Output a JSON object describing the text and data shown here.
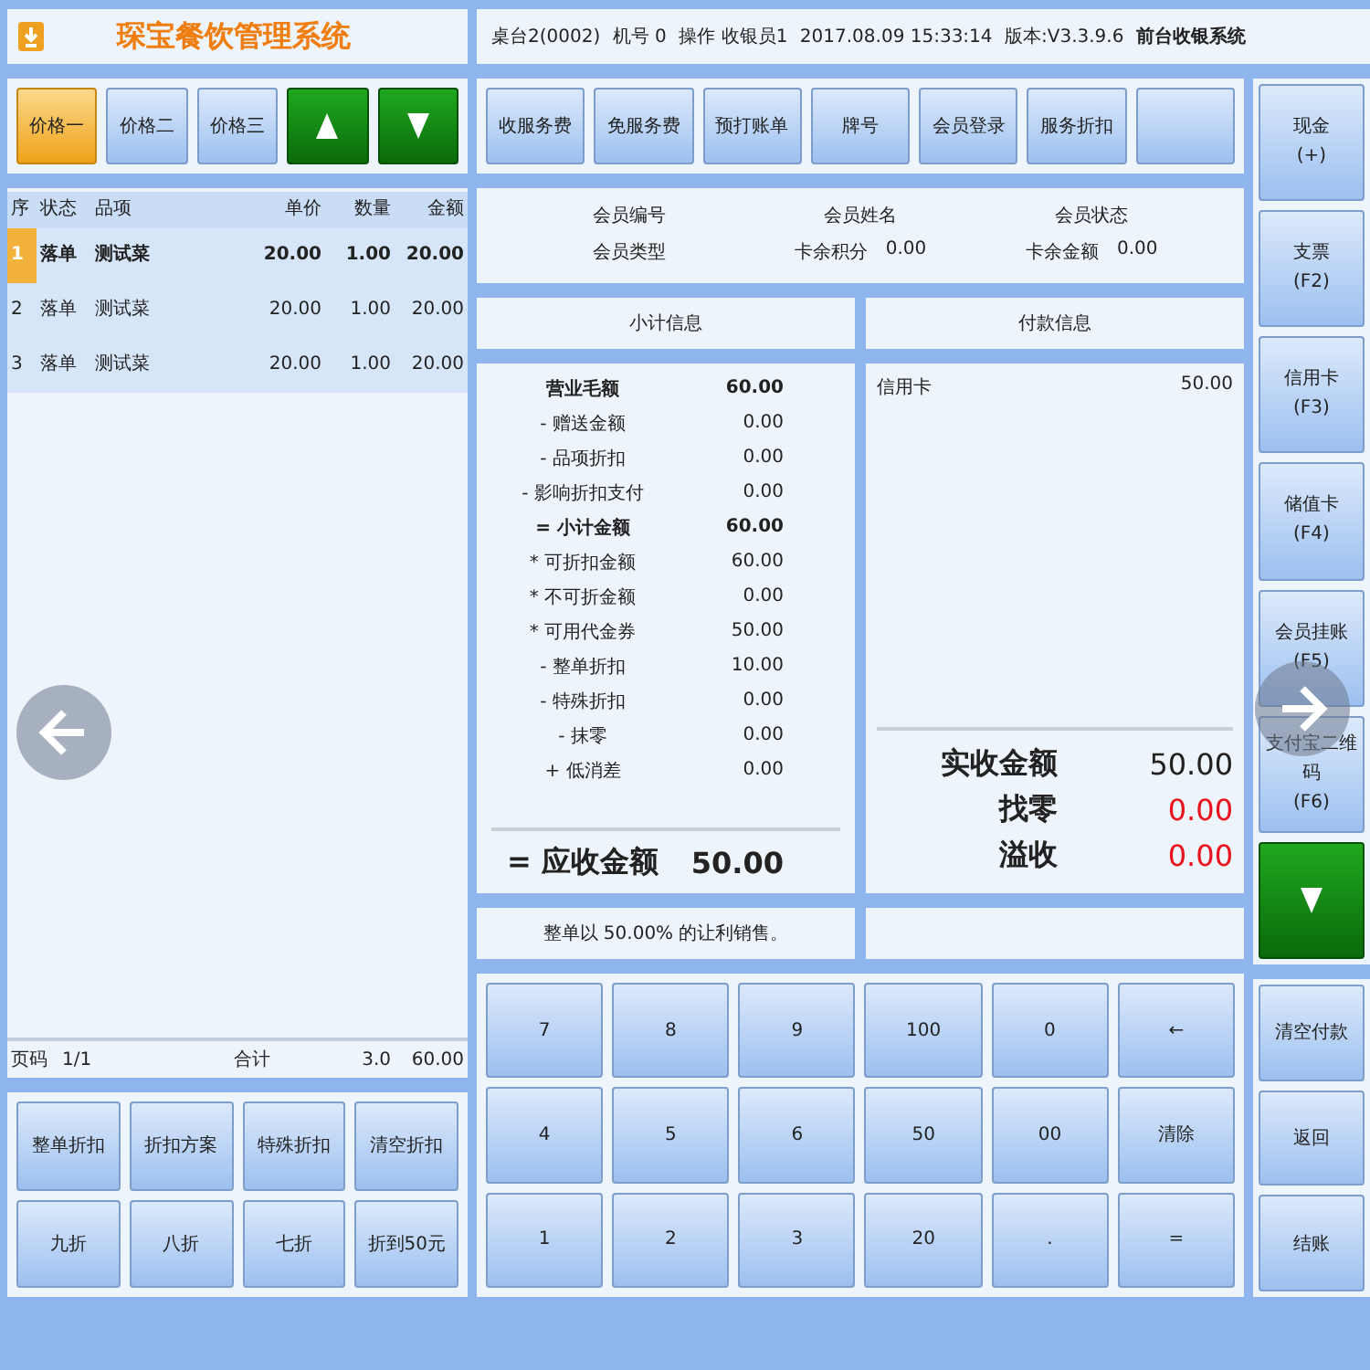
{
  "app": {
    "title": "琛宝餐饮管理系统"
  },
  "status_items": [
    {
      "text": "桌台2(0002)",
      "bold": false
    },
    {
      "text": "机号  0",
      "bold": false
    },
    {
      "text": "操作  收银员1",
      "bold": false
    },
    {
      "text": "2017.08.09 15:33:14",
      "bold": false
    },
    {
      "text": "版本:V3.3.9.6",
      "bold": false
    },
    {
      "text": "前台收银系统",
      "bold": true
    }
  ],
  "price_buttons": [
    {
      "label": "价格一",
      "selected": true
    },
    {
      "label": "价格二",
      "selected": false
    },
    {
      "label": "价格三",
      "selected": false
    }
  ],
  "order_table": {
    "columns": [
      "序",
      "状态",
      "品项",
      "单价",
      "数量",
      "金额"
    ],
    "rows": [
      {
        "cells": [
          "1",
          "落单",
          "测试菜",
          "20.00",
          "1.00",
          "20.00"
        ],
        "selected": true
      },
      {
        "cells": [
          "2",
          "落单",
          "测试菜",
          "20.00",
          "1.00",
          "20.00"
        ],
        "selected": false
      },
      {
        "cells": [
          "3",
          "落单",
          "测试菜",
          "20.00",
          "1.00",
          "20.00"
        ],
        "selected": false
      }
    ],
    "footer": {
      "page_label": "页码",
      "page": "1/1",
      "total_label": "合计",
      "quantity": "3.0",
      "amount": "60.00"
    }
  },
  "discount_buttons": [
    "整单折扣",
    "折扣方案",
    "特殊折扣",
    "清空折扣",
    "九折",
    "八折",
    "七折",
    "折到50元"
  ],
  "function_buttons": [
    {
      "kind": "text",
      "label": "收服务费"
    },
    {
      "kind": "text",
      "label": "免服务费"
    },
    {
      "kind": "text",
      "label": "预打账单"
    },
    {
      "kind": "text",
      "label": "牌号"
    },
    {
      "kind": "text",
      "label": "会员登录"
    },
    {
      "kind": "text",
      "label": "服务折扣"
    },
    {
      "kind": "blank"
    }
  ],
  "member_fields": [
    {
      "label": "会员编号"
    },
    {
      "label": "会员姓名"
    },
    {
      "label": "会员状态"
    },
    {
      "label": "会员类型"
    },
    {
      "label": "卡余积分",
      "value": "0.00"
    },
    {
      "label": "卡余金额",
      "value": "0.00"
    }
  ],
  "subtotal_header": "小计信息",
  "payment_header": "付款信息",
  "subtotal_lines": [
    {
      "label": "营业毛额",
      "value": "60.00",
      "bold": true
    },
    {
      "label": "- 赠送金额",
      "value": "0.00",
      "bold": false
    },
    {
      "label": "- 品项折扣",
      "value": "0.00",
      "bold": false
    },
    {
      "label": "- 影响折扣支付",
      "value": "0.00",
      "bold": false
    },
    {
      "label": "= 小计金额",
      "value": "60.00",
      "bold": true
    },
    {
      "label": "* 可折扣金额",
      "value": "60.00",
      "bold": false
    },
    {
      "label": "* 不可折金额",
      "value": "0.00",
      "bold": false
    },
    {
      "label": "* 可用代金券",
      "value": "50.00",
      "bold": false
    },
    {
      "label": "- 整单折扣",
      "value": "10.00",
      "bold": false
    },
    {
      "label": "- 特殊折扣",
      "value": "0.00",
      "bold": false
    },
    {
      "label": "- 抹零",
      "value": "0.00",
      "bold": false
    },
    {
      "label": "+ 低消差",
      "value": "0.00",
      "bold": false
    }
  ],
  "subtotal_total": {
    "label": "= 应收金额",
    "value": "50.00"
  },
  "payments": [
    {
      "method": "信用卡",
      "amount": "50.00"
    }
  ],
  "summary": [
    {
      "label": "实收金额",
      "value": "50.00",
      "alert": false
    },
    {
      "label": "找零",
      "value": "0.00",
      "alert": true
    },
    {
      "label": "溢收",
      "value": "0.00",
      "alert": true
    }
  ],
  "message": "整单以 50.00% 的让利销售。",
  "keypad": [
    "7",
    "8",
    "9",
    "100",
    "0",
    "←",
    "4",
    "5",
    "6",
    "50",
    "00",
    "清除",
    "1",
    "2",
    "3",
    "20",
    ".",
    "="
  ],
  "payment_methods": [
    {
      "label": "现金",
      "key": "(+)"
    },
    {
      "label": "支票",
      "key": "(F2)"
    },
    {
      "label": "信用卡",
      "key": "(F3)"
    },
    {
      "label": "储值卡",
      "key": "(F4)"
    },
    {
      "label": "会员挂账",
      "key": "(F5)"
    },
    {
      "label": "支付宝二维码",
      "key": "(F6)"
    }
  ],
  "actions": [
    "清空付款",
    "返回",
    "结账"
  ]
}
